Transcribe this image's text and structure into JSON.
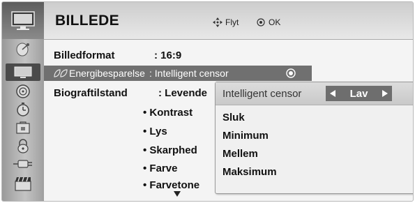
{
  "header": {
    "title": "BILLEDE",
    "move_hint": "Flyt",
    "ok_hint": "OK"
  },
  "menu": {
    "rows": [
      {
        "label": "Billedformat",
        "value": ": 16:9"
      },
      {
        "label": "Energibesparelse",
        "value": ": Intelligent censor"
      },
      {
        "label": "Biograftilstand",
        "value": ": Levende"
      }
    ],
    "sub_items": [
      "• Kontrast",
      "• Lys",
      "• Skarphed",
      "• Farve",
      "• Farvetone"
    ]
  },
  "popup": {
    "title": "Intelligent censor",
    "selected": "Lav",
    "options": [
      "Sluk",
      "Minimum",
      "Mellem",
      "Maksimum"
    ]
  },
  "sidebar": {
    "icons": [
      "tv-icon",
      "satellite-dish-icon",
      "picture-icon",
      "disc-icon",
      "clock-icon",
      "lock-screen-icon",
      "padlock-icon",
      "usb-plug-icon",
      "clapperboard-icon"
    ]
  },
  "colors": {
    "highlight": "#707070",
    "selector": "#6e6e6e"
  }
}
